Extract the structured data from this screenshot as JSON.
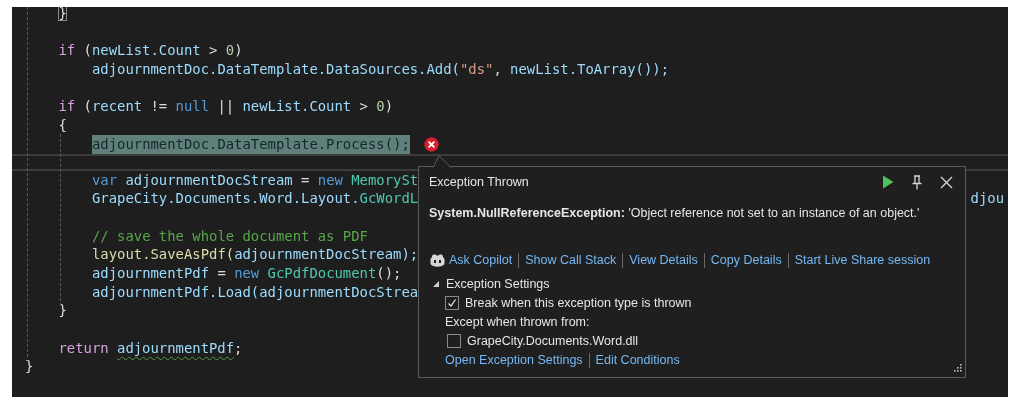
{
  "editor": {
    "lines": [
      {
        "kind": "code",
        "highlighted": false,
        "error": false,
        "tokens": [
          {
            "kind": "matched-brace",
            "text": "    }"
          }
        ]
      },
      {
        "kind": "blank"
      },
      {
        "kind": "code",
        "highlighted": false,
        "error": false,
        "tokens": [
          {
            "kind": "control",
            "text": "    if"
          },
          {
            "kind": "plain",
            "text": " ("
          },
          {
            "kind": "ident",
            "text": "newList.Count"
          },
          {
            "kind": "plain",
            "text": " > "
          },
          {
            "kind": "number",
            "text": "0"
          },
          {
            "kind": "plain",
            "text": ")"
          }
        ]
      },
      {
        "kind": "code",
        "highlighted": false,
        "error": false,
        "tokens": [
          {
            "kind": "ident",
            "text": "        adjournmentDoc.DataTemplate.DataSources.Add("
          },
          {
            "kind": "string",
            "text": "\"ds\""
          },
          {
            "kind": "plain",
            "text": ", "
          },
          {
            "kind": "ident",
            "text": "newList.ToArray());"
          }
        ]
      },
      {
        "kind": "blank"
      },
      {
        "kind": "code",
        "highlighted": false,
        "error": false,
        "tokens": [
          {
            "kind": "control",
            "text": "    if"
          },
          {
            "kind": "plain",
            "text": " ("
          },
          {
            "kind": "ident",
            "text": "recent"
          },
          {
            "kind": "plain",
            "text": " != "
          },
          {
            "kind": "keyword",
            "text": "null"
          },
          {
            "kind": "plain",
            "text": " || "
          },
          {
            "kind": "ident",
            "text": "newList.Count"
          },
          {
            "kind": "plain",
            "text": " > "
          },
          {
            "kind": "number",
            "text": "0"
          },
          {
            "kind": "plain",
            "text": ")"
          }
        ]
      },
      {
        "kind": "code",
        "highlighted": false,
        "error": false,
        "tokens": [
          {
            "kind": "plain",
            "text": "    {"
          }
        ]
      },
      {
        "kind": "code",
        "highlighted": true,
        "error": true,
        "tokens": [
          {
            "kind": "ident",
            "text": "        adjournmentDoc.DataTemplate.Process();"
          }
        ]
      },
      {
        "kind": "code",
        "highlighted": false,
        "error": false,
        "tokens": [
          {
            "kind": "keyword",
            "text": "        var"
          },
          {
            "kind": "ident",
            "text": " adjournmentDocStream"
          },
          {
            "kind": "plain",
            "text": " = "
          },
          {
            "kind": "keyword",
            "text": "new"
          },
          {
            "kind": "type",
            "text": " MemorySt"
          }
        ]
      },
      {
        "kind": "code",
        "highlighted": false,
        "error": false,
        "tokens": [
          {
            "kind": "ident",
            "text": "        GrapeCity.Documents.Word.Layout."
          },
          {
            "kind": "type",
            "text": "GcWordL"
          }
        ],
        "tail": "djou"
      },
      {
        "kind": "blank"
      },
      {
        "kind": "code",
        "highlighted": false,
        "error": false,
        "tokens": [
          {
            "kind": "comment",
            "text": "        // save the whole document as PDF"
          }
        ]
      },
      {
        "kind": "code",
        "highlighted": false,
        "error": false,
        "tokens": [
          {
            "kind": "method",
            "text": "        layout.SaveAsPdf("
          },
          {
            "kind": "ident",
            "text": "adjournmentDocStream);"
          }
        ]
      },
      {
        "kind": "code",
        "highlighted": false,
        "error": false,
        "tokens": [
          {
            "kind": "ident",
            "text": "        adjournmentPdf"
          },
          {
            "kind": "plain",
            "text": " = "
          },
          {
            "kind": "keyword",
            "text": "new"
          },
          {
            "kind": "type",
            "text": " GcPdfDocument"
          },
          {
            "kind": "plain",
            "text": "();"
          }
        ]
      },
      {
        "kind": "code",
        "highlighted": false,
        "error": false,
        "tokens": [
          {
            "kind": "ident",
            "text": "        adjournmentPdf.Load(adjournmentDocStrea"
          }
        ]
      },
      {
        "kind": "code",
        "highlighted": false,
        "error": false,
        "tokens": [
          {
            "kind": "plain",
            "text": "    }"
          }
        ]
      },
      {
        "kind": "blank"
      },
      {
        "kind": "code",
        "highlighted": false,
        "error": false,
        "tokens": [
          {
            "kind": "control",
            "text": "    return "
          },
          {
            "kind": "squiggled",
            "text": "adjournmentPdf"
          },
          {
            "kind": "plain",
            "text": ";"
          }
        ]
      },
      {
        "kind": "code",
        "highlighted": false,
        "error": false,
        "tokens": [
          {
            "kind": "plain",
            "text": "}"
          }
        ]
      }
    ]
  },
  "exception_popup": {
    "title": "Exception Thrown",
    "message": "**System.NullReferenceException:** 'Object reference not set to an instance of an object.'",
    "actions": [
      {
        "kind": "copilot",
        "label": "Ask Copilot"
      },
      {
        "kind": "link",
        "label": "Show Call Stack"
      },
      {
        "kind": "link",
        "label": "View Details"
      },
      {
        "kind": "link",
        "label": "Copy Details"
      },
      {
        "kind": "link",
        "label": "Start Live Share session"
      }
    ],
    "settings": {
      "label": "Exception Settings",
      "expanded": true,
      "options": [
        {
          "kind": "checkbox",
          "label": "Break when this exception type is thrown",
          "checked": true
        },
        {
          "kind": "text",
          "label": "Except when thrown from:",
          "children": [
            {
              "kind": "checkbox",
              "label": "GrapeCity.Documents.Word.dll",
              "checked": false
            }
          ]
        }
      ]
    },
    "footer_links": [
      "Open Exception Settings",
      "Edit Conditions"
    ]
  }
}
